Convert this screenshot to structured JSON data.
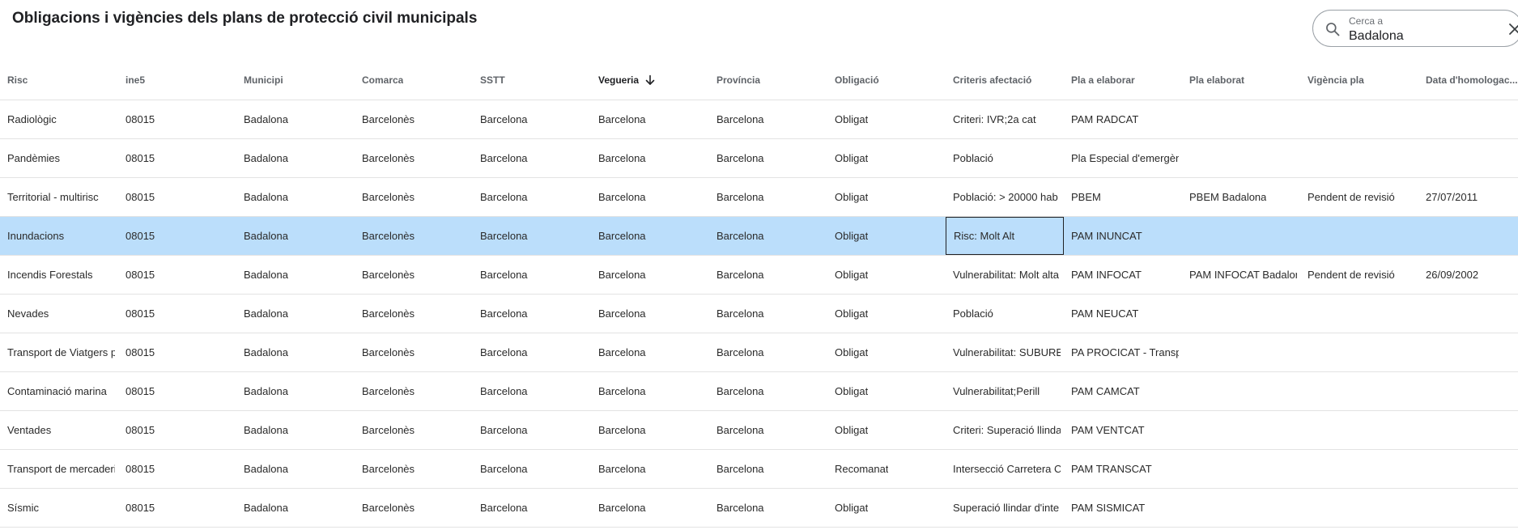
{
  "page": {
    "title": "Obligacions i vigències dels plans de protecció civil municipals"
  },
  "search": {
    "label": "Cerca a",
    "value": "Badalona"
  },
  "icons": {
    "search": "search-icon",
    "clear": "close-icon",
    "sort": "arrow-down-icon"
  },
  "colors": {
    "selected_row": "#bbdefb",
    "divider": "#e3e3e3"
  },
  "table": {
    "columns": [
      "Risc",
      "ine5",
      "Municipi",
      "Comarca",
      "SSTT",
      "Vegueria",
      "Província",
      "Obligació",
      "Criteris afectació",
      "Pla a elaborar",
      "Pla elaborat",
      "Vigència pla",
      "Data d'homologac..."
    ],
    "sorted_column": "Vegueria",
    "sort_direction": "descending",
    "selected_row": "Inundacions",
    "focused_cell": "Risc: Molt Alt",
    "rows": [
      [
        "Radiològic",
        "08015",
        "Badalona",
        "Barcelonès",
        "Barcelona",
        "Barcelona",
        "Barcelona",
        "Obligat",
        "Criteri: IVR;2a cat",
        "PAM RADCAT",
        "",
        "",
        ""
      ],
      [
        "Pandèmies",
        "08015",
        "Badalona",
        "Barcelonès",
        "Barcelona",
        "Barcelona",
        "Barcelona",
        "Obligat",
        "Població",
        "Pla Especial d'emergèn",
        "",
        "",
        ""
      ],
      [
        "Territorial - multirisc",
        "08015",
        "Badalona",
        "Barcelonès",
        "Barcelona",
        "Barcelona",
        "Barcelona",
        "Obligat",
        "Població: > 20000 hab",
        "PBEM",
        "PBEM Badalona",
        "Pendent de revisió",
        "27/07/2011"
      ],
      [
        "Inundacions",
        "08015",
        "Badalona",
        "Barcelonès",
        "Barcelona",
        "Barcelona",
        "Barcelona",
        "Obligat",
        "Risc: Molt Alt",
        "PAM INUNCAT",
        "",
        "",
        ""
      ],
      [
        "Incendis Forestals",
        "08015",
        "Badalona",
        "Barcelonès",
        "Barcelona",
        "Barcelona",
        "Barcelona",
        "Obligat",
        "Vulnerabilitat: Molt alta",
        "PAM INFOCAT",
        "PAM INFOCAT Badalona",
        "Pendent de revisió",
        "26/09/2002"
      ],
      [
        "Nevades",
        "08015",
        "Badalona",
        "Barcelonès",
        "Barcelona",
        "Barcelona",
        "Barcelona",
        "Obligat",
        "Població",
        "PAM NEUCAT",
        "",
        "",
        ""
      ],
      [
        "Transport de Viatgers p",
        "08015",
        "Badalona",
        "Barcelonès",
        "Barcelona",
        "Barcelona",
        "Barcelona",
        "Obligat",
        "Vulnerabilitat: SUBURB",
        "PA PROCICAT - Transp",
        "",
        "",
        ""
      ],
      [
        "Contaminació marina",
        "08015",
        "Badalona",
        "Barcelonès",
        "Barcelona",
        "Barcelona",
        "Barcelona",
        "Obligat",
        "Vulnerabilitat;Perill",
        "PAM CAMCAT",
        "",
        "",
        ""
      ],
      [
        "Ventades",
        "08015",
        "Badalona",
        "Barcelonès",
        "Barcelona",
        "Barcelona",
        "Barcelona",
        "Obligat",
        "Criteri: Superació llinda",
        "PAM VENTCAT",
        "",
        "",
        ""
      ],
      [
        "Transport de mercaderi",
        "08015",
        "Badalona",
        "Barcelonès",
        "Barcelona",
        "Barcelona",
        "Barcelona",
        "Recomanat",
        "Intersecció Carretera C",
        "PAM TRANSCAT",
        "",
        "",
        ""
      ],
      [
        "Sísmic",
        "08015",
        "Badalona",
        "Barcelonès",
        "Barcelona",
        "Barcelona",
        "Barcelona",
        "Obligat",
        "Superació llindar d'inte",
        "PAM SISMICAT",
        "",
        "",
        ""
      ]
    ]
  }
}
